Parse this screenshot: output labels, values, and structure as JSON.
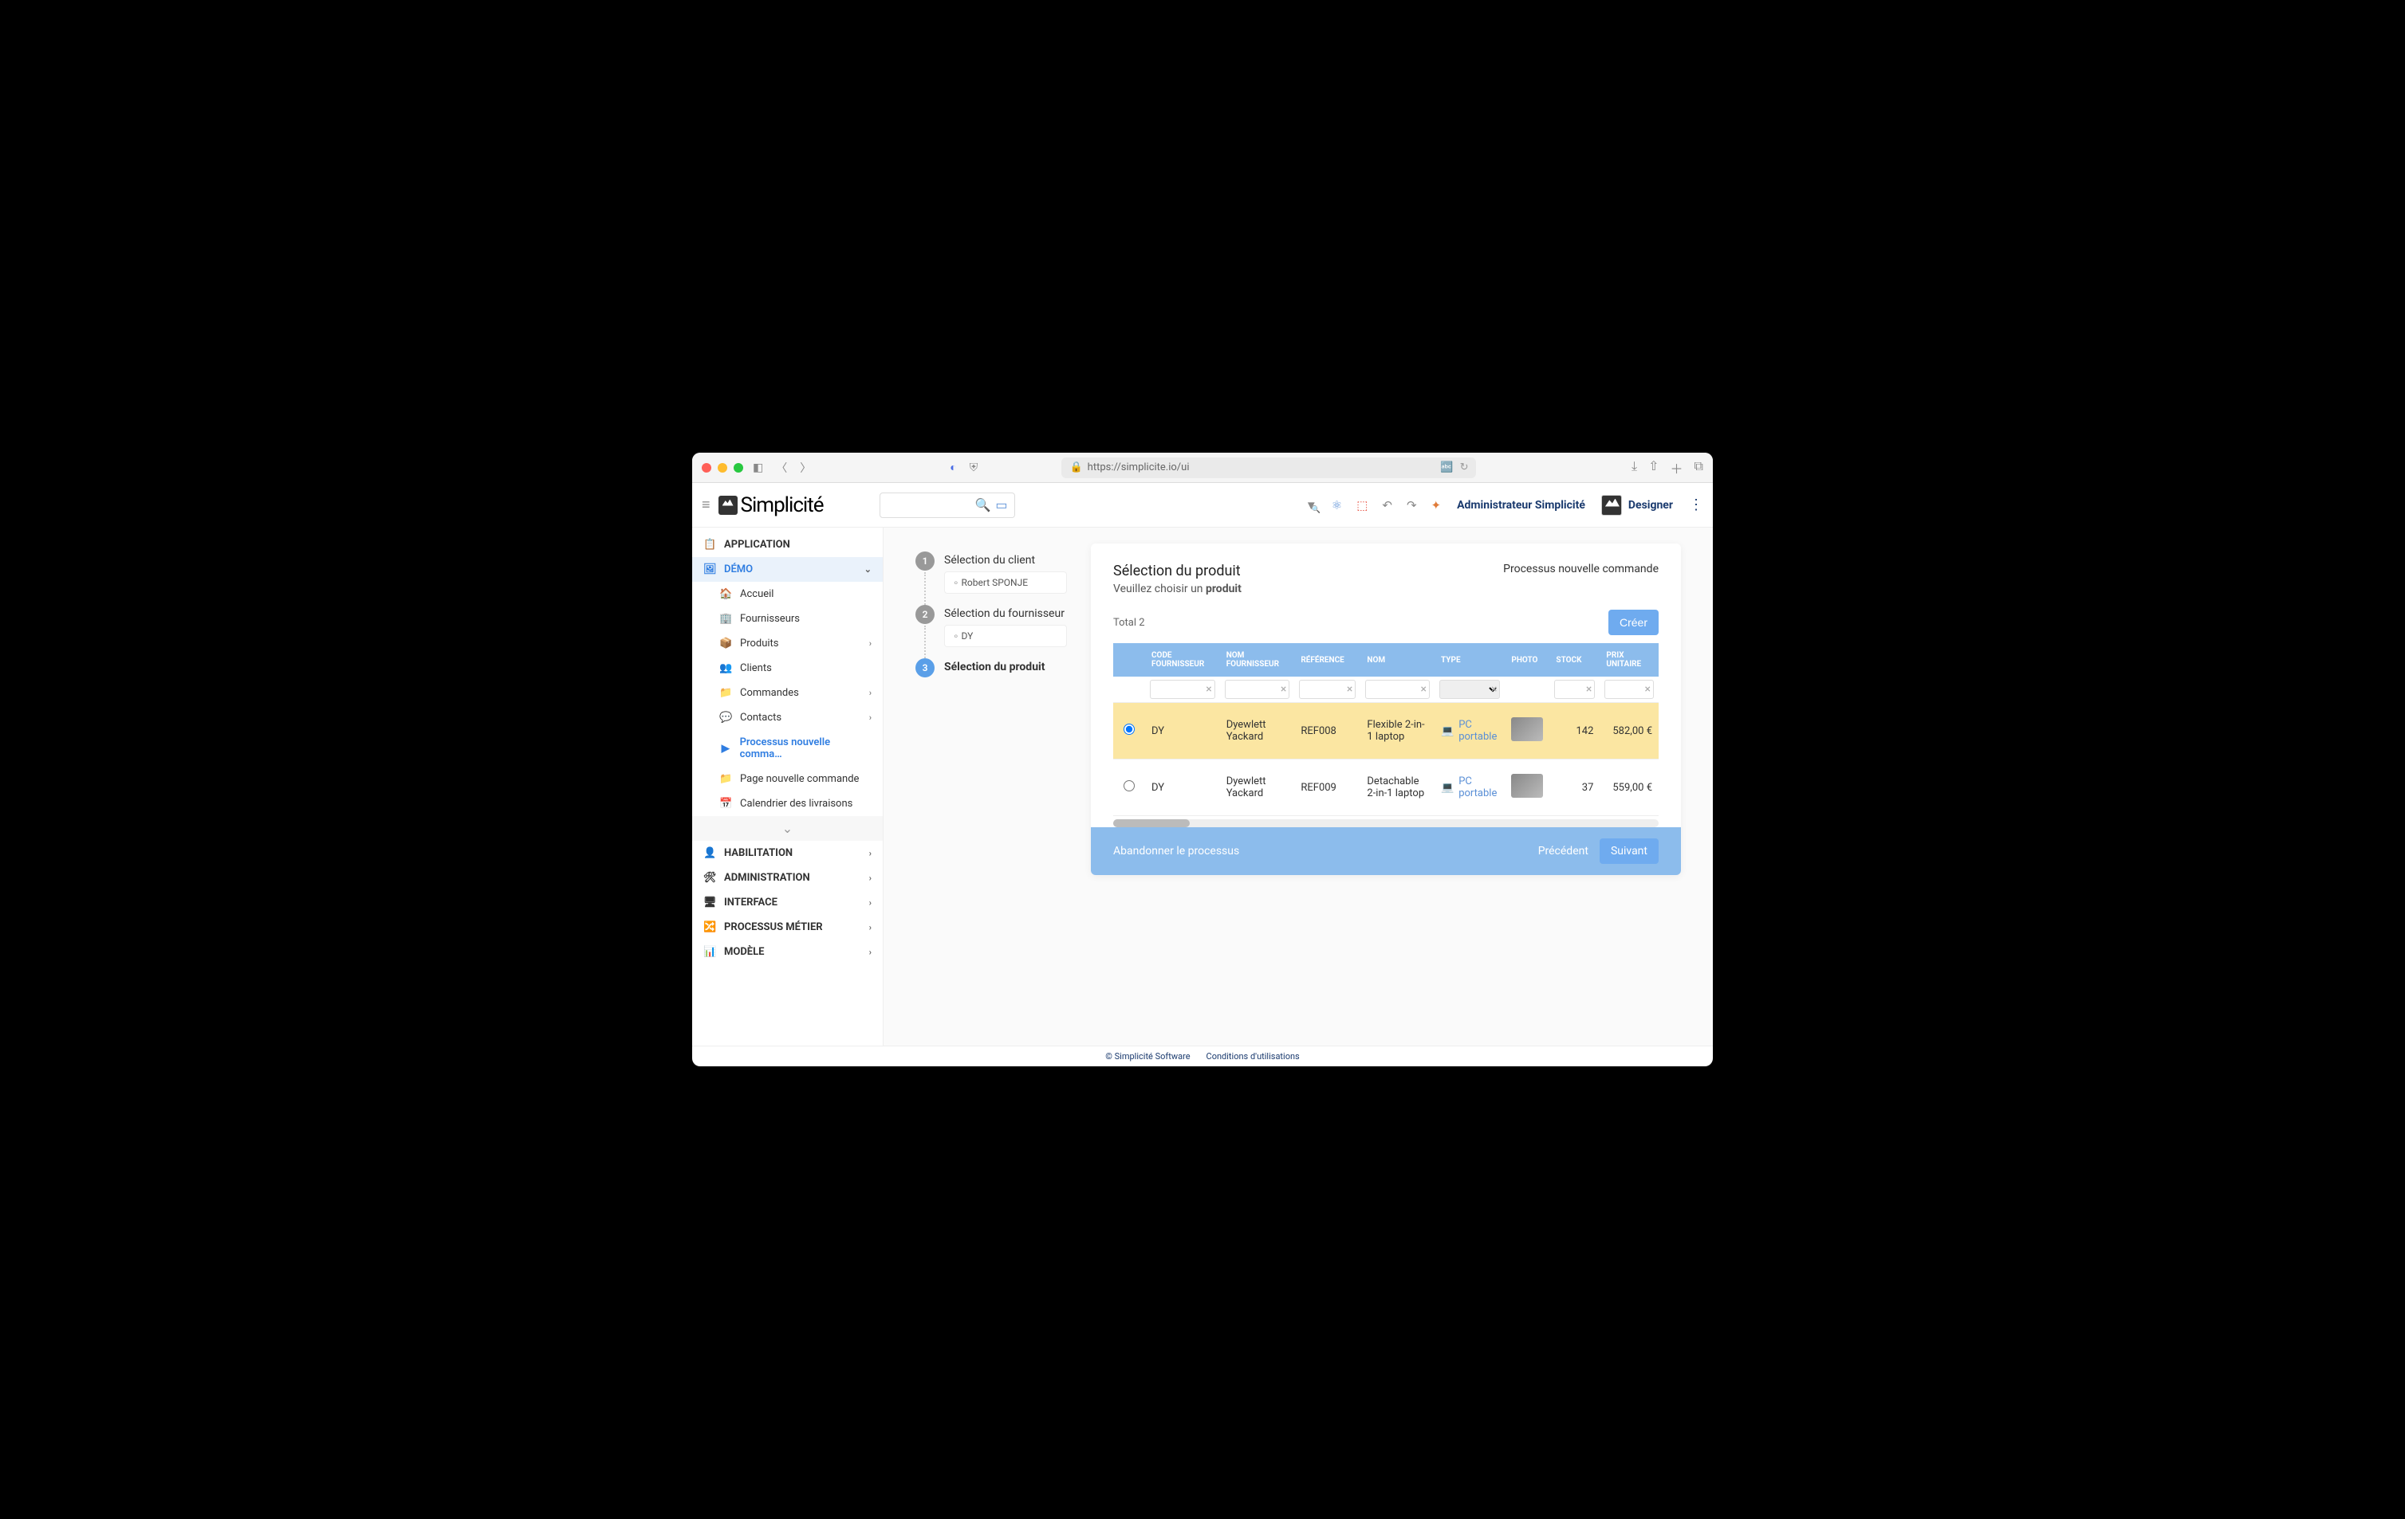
{
  "browser": {
    "url": "https://simplicite.io/ui"
  },
  "header": {
    "logo": "Simplicité",
    "user": "Administrateur Simplicité",
    "role": "Designer"
  },
  "sidebar": {
    "application": "APPLICATION",
    "demo": "DÉMO",
    "items": [
      {
        "icon": "🏠",
        "label": "Accueil"
      },
      {
        "icon": "🏢",
        "label": "Fournisseurs"
      },
      {
        "icon": "📦",
        "label": "Produits",
        "chev": true
      },
      {
        "icon": "👥",
        "label": "Clients"
      },
      {
        "icon": "📁",
        "label": "Commandes",
        "chev": true
      },
      {
        "icon": "💬",
        "label": "Contacts",
        "chev": true
      },
      {
        "icon": "▶",
        "label": "Processus nouvelle comma…",
        "active": true
      },
      {
        "icon": "📁",
        "label": "Page nouvelle commande"
      },
      {
        "icon": "📅",
        "label": "Calendrier des livraisons"
      }
    ],
    "groups": [
      {
        "icon": "👤",
        "label": "HABILITATION"
      },
      {
        "icon": "🛠",
        "label": "ADMINISTRATION"
      },
      {
        "icon": "🖥",
        "label": "INTERFACE"
      },
      {
        "icon": "🔀",
        "label": "PROCESSUS MÉTIER"
      },
      {
        "icon": "📊",
        "label": "MODÈLE"
      }
    ]
  },
  "steps": [
    {
      "num": "1",
      "title": "Sélection du client",
      "sub": "Robert SPONJE"
    },
    {
      "num": "2",
      "title": "Sélection du fournisseur",
      "sub": "DY"
    },
    {
      "num": "3",
      "title": "Sélection du produit",
      "current": true
    }
  ],
  "panel": {
    "title": "Sélection du produit",
    "subtitle_prefix": "Veuillez choisir un ",
    "subtitle_bold": "produit",
    "process": "Processus nouvelle commande",
    "total": "Total 2",
    "create": "Créer",
    "columns": [
      "",
      "CODE FOURNISSEUR",
      "NOM FOURNISSEUR",
      "RÉFÉRENCE",
      "NOM",
      "TYPE",
      "PHOTO",
      "STOCK",
      "PRIX UNITAIRE"
    ],
    "rows": [
      {
        "selected": true,
        "code": "DY",
        "fournisseur": "Dyewlett Yackard",
        "ref": "REF008",
        "nom": "Flexible 2-in-1 laptop",
        "type": "PC portable",
        "stock": "142",
        "prix": "582,00 €"
      },
      {
        "selected": false,
        "code": "DY",
        "fournisseur": "Dyewlett Yackard",
        "ref": "REF009",
        "nom": "Detachable 2-in-1 laptop",
        "type": "PC portable",
        "stock": "37",
        "prix": "559,00 €"
      }
    ],
    "abandon": "Abandonner le processus",
    "prev": "Précédent",
    "next": "Suivant"
  },
  "footer": {
    "copyright": "© Simplicité Software",
    "terms": "Conditions d'utilisations"
  }
}
